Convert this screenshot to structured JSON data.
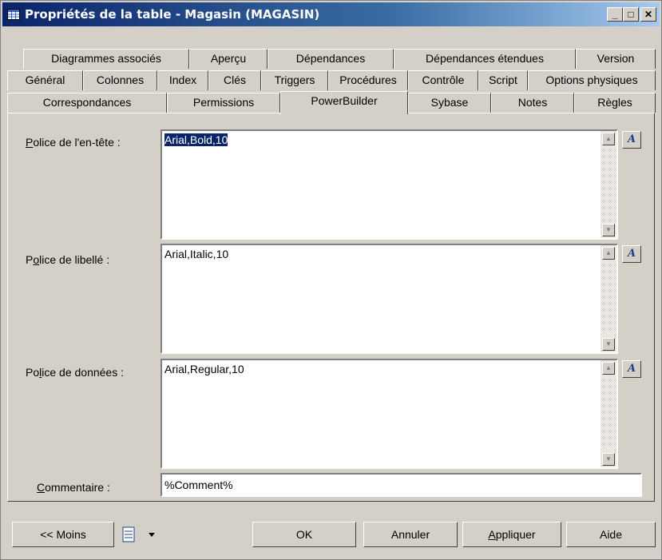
{
  "window": {
    "title": "Propriétés de la table - Magasin (MAGASIN)"
  },
  "title_buttons": {
    "minimize": "_",
    "maximize": "□",
    "close": "✕"
  },
  "tabs": {
    "row1": [
      "Diagrammes associés",
      "Aperçu",
      "Dépendances",
      "Dépendances étendues",
      "Version"
    ],
    "row2": [
      "Général",
      "Colonnes",
      "Index",
      "Clés",
      "Triggers",
      "Procédures",
      "Contrôle",
      "Script",
      "Options physiques"
    ],
    "row3": [
      "Correspondances",
      "Permissions",
      "PowerBuilder",
      "Sybase",
      "Notes",
      "Règles"
    ],
    "active": "PowerBuilder"
  },
  "form": {
    "header_font": {
      "label_pre": "",
      "label_u": "P",
      "label_post": "olice de l'en-tête :",
      "value": "Arial,Bold,10"
    },
    "label_font": {
      "label_pre": "P",
      "label_u": "o",
      "label_post": "lice de libellé :",
      "value": "Arial,Italic,10"
    },
    "data_font": {
      "label_pre": "Po",
      "label_u": "l",
      "label_post": "ice de données :",
      "value": "Arial,Regular,10"
    },
    "comment": {
      "label_pre": "",
      "label_u": "C",
      "label_post": "ommentaire :",
      "value": "%Comment%"
    },
    "font_button_glyph": "A"
  },
  "buttons": {
    "less": "<< Moins",
    "ok": "OK",
    "cancel": "Annuler",
    "apply_pre": "",
    "apply_u": "A",
    "apply_post": "ppliquer",
    "help": "Aide"
  },
  "icons": {
    "title": "table-icon",
    "menu": "properties-menu-icon",
    "font_button": "font-picker-icon"
  }
}
